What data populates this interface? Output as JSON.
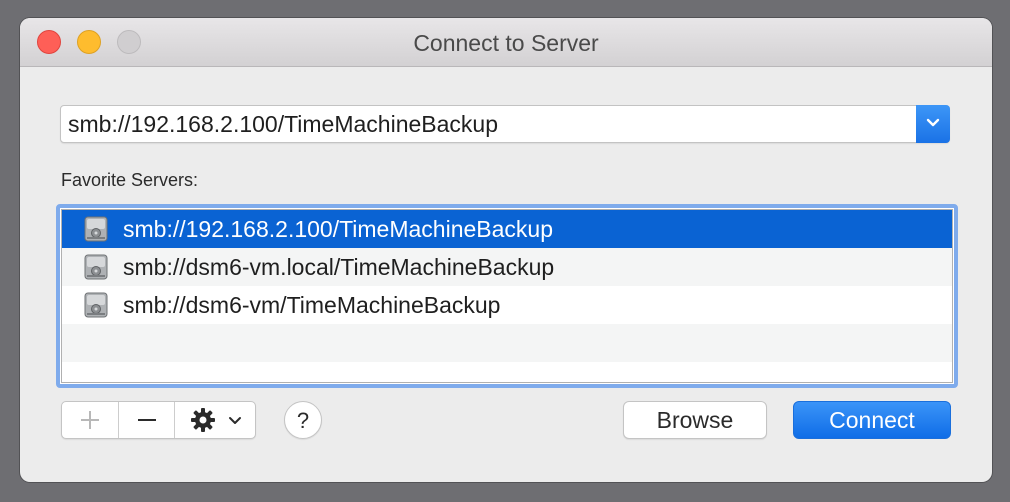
{
  "window": {
    "title": "Connect to Server"
  },
  "server_address": {
    "value": "smb://192.168.2.100/TimeMachineBackup"
  },
  "favorites": {
    "label": "Favorite Servers:",
    "items": [
      {
        "label": "smb://192.168.2.100/TimeMachineBackup",
        "icon": "network-disk-icon",
        "selected": true
      },
      {
        "label": "smb://dsm6-vm.local/TimeMachineBackup",
        "icon": "network-disk-icon",
        "selected": false
      },
      {
        "label": "smb://dsm6-vm/TimeMachineBackup",
        "icon": "network-disk-icon",
        "selected": false
      }
    ]
  },
  "toolbar": {
    "add_icon": "plus-icon",
    "remove_icon": "minus-icon",
    "action_icon": "gear-icon",
    "help_label": "?",
    "browse_label": "Browse",
    "connect_label": "Connect"
  },
  "colors": {
    "accent": "#1a72e6",
    "selection": "#0a63d3",
    "close": "#fe5f57",
    "minimize": "#febc2e",
    "zoom_disabled": "#d0ced0"
  }
}
